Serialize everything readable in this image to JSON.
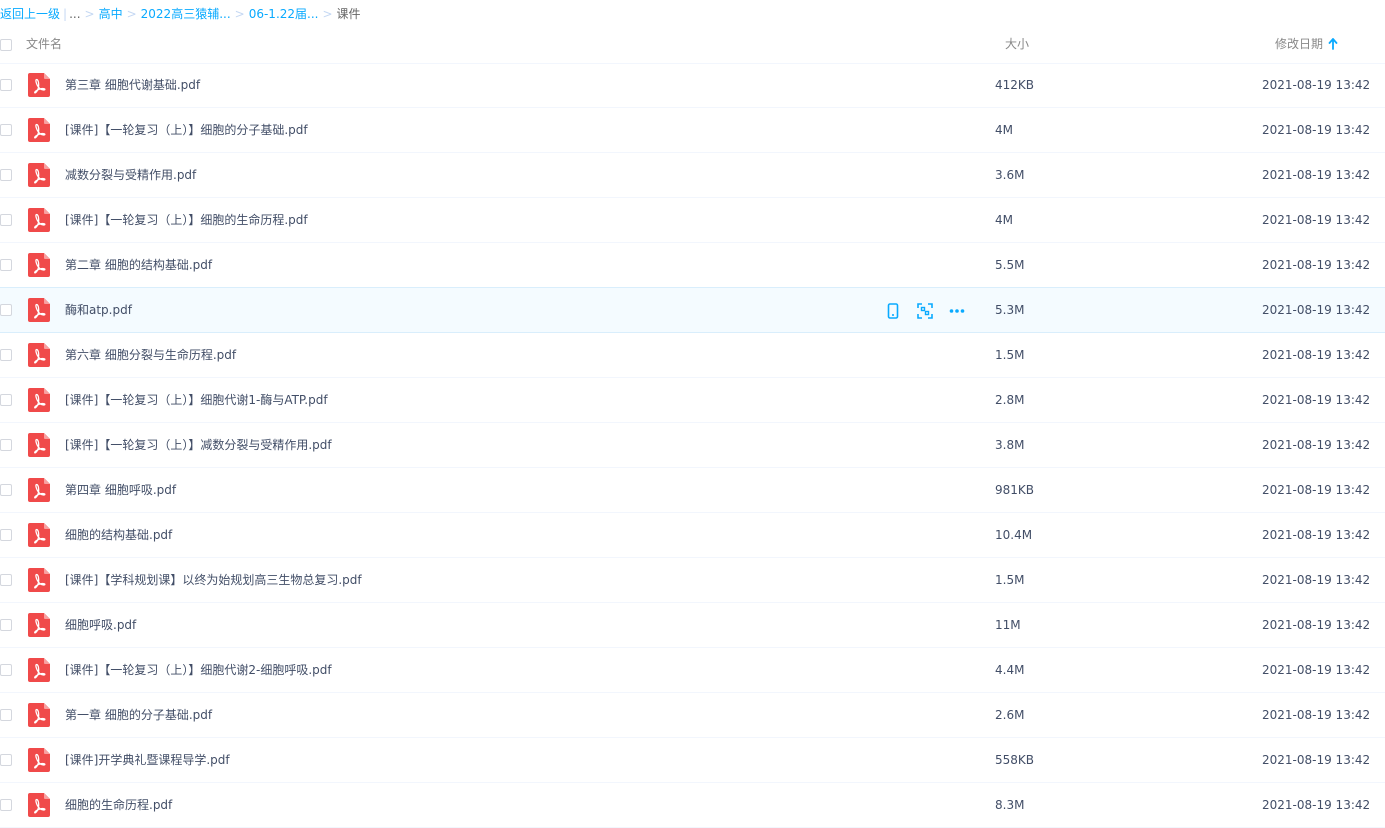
{
  "breadcrumb": {
    "back": "返回上一级",
    "ellipsis": "...",
    "items": [
      "高中",
      "2022高三猿辅...",
      "06-1.22届..."
    ],
    "current": "课件",
    "separator": ">"
  },
  "header": {
    "name": "文件名",
    "size": "大小",
    "date": "修改日期",
    "sort_icon": "arrow-up-icon"
  },
  "colors": {
    "accent": "#09aaff",
    "pdf_icon": "#f04a4a",
    "hover_row": "#f4fbff"
  },
  "hovered_row_index": 5,
  "row_actions": [
    "phone-icon",
    "qr-scan-icon",
    "more-icon"
  ],
  "files": [
    {
      "name": "第三章 细胞代谢基础.pdf",
      "size": "412KB",
      "date": "2021-08-19 13:42"
    },
    {
      "name": "[课件]【一轮复习（上）】细胞的分子基础.pdf",
      "size": "4M",
      "date": "2021-08-19 13:42"
    },
    {
      "name": "减数分裂与受精作用.pdf",
      "size": "3.6M",
      "date": "2021-08-19 13:42"
    },
    {
      "name": "[课件]【一轮复习（上）】细胞的生命历程.pdf",
      "size": "4M",
      "date": "2021-08-19 13:42"
    },
    {
      "name": "第二章 细胞的结构基础.pdf",
      "size": "5.5M",
      "date": "2021-08-19 13:42"
    },
    {
      "name": "酶和atp.pdf",
      "size": "5.3M",
      "date": "2021-08-19 13:42"
    },
    {
      "name": "第六章 细胞分裂与生命历程.pdf",
      "size": "1.5M",
      "date": "2021-08-19 13:42"
    },
    {
      "name": "[课件]【一轮复习（上）】细胞代谢1-酶与ATP.pdf",
      "size": "2.8M",
      "date": "2021-08-19 13:42"
    },
    {
      "name": "[课件]【一轮复习（上）】减数分裂与受精作用.pdf",
      "size": "3.8M",
      "date": "2021-08-19 13:42"
    },
    {
      "name": "第四章 细胞呼吸.pdf",
      "size": "981KB",
      "date": "2021-08-19 13:42"
    },
    {
      "name": "细胞的结构基础.pdf",
      "size": "10.4M",
      "date": "2021-08-19 13:42"
    },
    {
      "name": "[课件]【学科规划课】以终为始规划高三生物总复习.pdf",
      "size": "1.5M",
      "date": "2021-08-19 13:42"
    },
    {
      "name": "细胞呼吸.pdf",
      "size": "11M",
      "date": "2021-08-19 13:42"
    },
    {
      "name": "[课件]【一轮复习（上）】细胞代谢2-细胞呼吸.pdf",
      "size": "4.4M",
      "date": "2021-08-19 13:42"
    },
    {
      "name": "第一章 细胞的分子基础.pdf",
      "size": "2.6M",
      "date": "2021-08-19 13:42"
    },
    {
      "name": "[课件]开学典礼暨课程导学.pdf",
      "size": "558KB",
      "date": "2021-08-19 13:42"
    },
    {
      "name": "细胞的生命历程.pdf",
      "size": "8.3M",
      "date": "2021-08-19 13:42"
    }
  ]
}
